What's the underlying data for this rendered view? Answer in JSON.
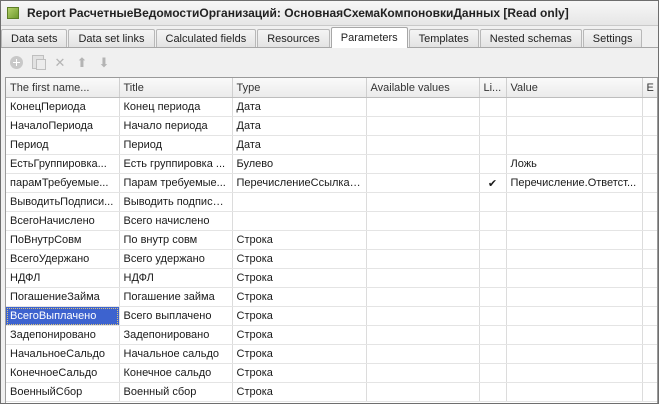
{
  "window": {
    "title": "Report  РасчетныеВедомостиОрганизаций: ОсновнаяСхемаКомпоновкиДанных [Read only]"
  },
  "tabs": [
    {
      "label": "Data sets",
      "active": false
    },
    {
      "label": "Data set links",
      "active": false
    },
    {
      "label": "Calculated fields",
      "active": false
    },
    {
      "label": "Resources",
      "active": false
    },
    {
      "label": "Parameters",
      "active": true
    },
    {
      "label": "Templates",
      "active": false
    },
    {
      "label": "Nested schemas",
      "active": false
    },
    {
      "label": "Settings",
      "active": false
    }
  ],
  "toolbar": {
    "icons": [
      "add-icon",
      "copy-icon",
      "delete-icon",
      "move-up-icon",
      "move-down-icon"
    ]
  },
  "grid": {
    "columns": [
      "The first name...",
      "Title",
      "Type",
      "Available values",
      "Li...",
      "Value",
      "E"
    ],
    "selected_row": 11,
    "rows": [
      [
        "КонецПериода",
        "Конец периода",
        "Дата",
        "",
        "",
        "",
        ""
      ],
      [
        "НачалоПериода",
        "Начало периода",
        "Дата",
        "",
        "",
        "",
        ""
      ],
      [
        "Период",
        "Период",
        "Дата",
        "",
        "",
        "",
        ""
      ],
      [
        "ЕстьГруппировка...",
        "Есть группировка ...",
        "Булево",
        "",
        "",
        "Ложь",
        ""
      ],
      [
        "парамТребуемые...",
        "Парам требуемые...",
        "ПеречислениеСсылка....",
        "",
        "✔",
        "Перечисление.Ответст...",
        ""
      ],
      [
        "ВыводитьПодписи...",
        "Выводить подписи...",
        "",
        "",
        "",
        "",
        ""
      ],
      [
        "ВсегоНачислено",
        "Всего начислено",
        "",
        "",
        "",
        "",
        ""
      ],
      [
        "ПоВнутрСовм",
        "По внутр совм",
        "Строка",
        "",
        "",
        "",
        ""
      ],
      [
        "ВсегоУдержано",
        "Всего удержано",
        "Строка",
        "",
        "",
        "",
        ""
      ],
      [
        "НДФЛ",
        "НДФЛ",
        "Строка",
        "",
        "",
        "",
        ""
      ],
      [
        "ПогашениеЗайма",
        "Погашение займа",
        "Строка",
        "",
        "",
        "",
        ""
      ],
      [
        "ВсегоВыплачено",
        "Всего выплачено",
        "Строка",
        "",
        "",
        "",
        ""
      ],
      [
        "Задепонировано",
        "Задепонировано",
        "Строка",
        "",
        "",
        "",
        ""
      ],
      [
        "НачальноеСальдо",
        "Начальное сальдо",
        "Строка",
        "",
        "",
        "",
        ""
      ],
      [
        "КонечноеСальдо",
        "Конечное сальдо",
        "Строка",
        "",
        "",
        "",
        ""
      ],
      [
        "ВоенныйСбор",
        "Военный сбор",
        "Строка",
        "",
        "",
        "",
        ""
      ]
    ]
  }
}
